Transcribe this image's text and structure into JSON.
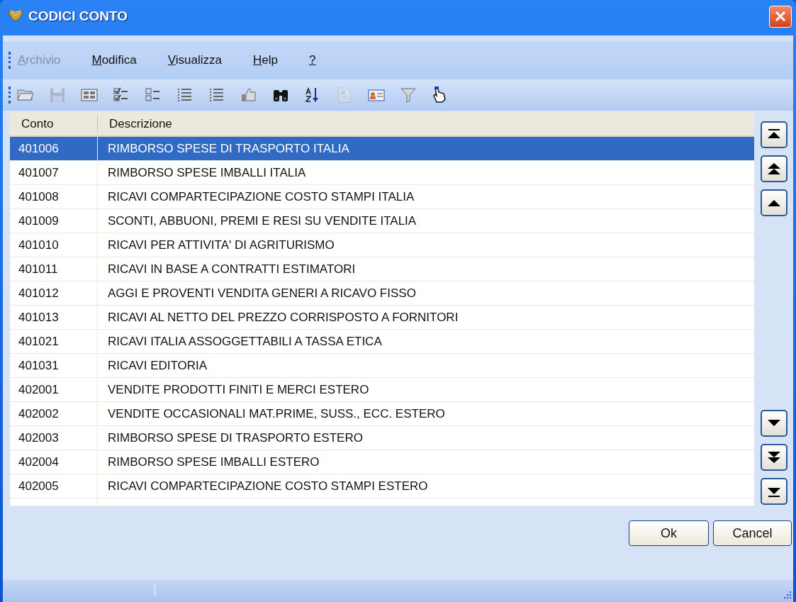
{
  "window": {
    "title": "CODICI CONTO"
  },
  "menu": [
    {
      "label": "Archivio",
      "disabled": true
    },
    {
      "label": "Modifica",
      "disabled": false
    },
    {
      "label": "Visualizza",
      "disabled": false
    },
    {
      "label": "Help",
      "disabled": false
    },
    {
      "label": "?",
      "disabled": false
    }
  ],
  "toolbar": [
    {
      "kind": "open",
      "disabled": false
    },
    {
      "kind": "save",
      "disabled": true
    },
    {
      "kind": "form",
      "disabled": false
    },
    {
      "kind": "checklist",
      "disabled": false
    },
    {
      "kind": "list",
      "disabled": false
    },
    {
      "kind": "dotlist",
      "disabled": false
    },
    {
      "kind": "dotlist",
      "disabled": false
    },
    {
      "kind": "thumb",
      "disabled": false
    },
    {
      "kind": "binoculars",
      "disabled": false
    },
    {
      "kind": "sort",
      "disabled": false
    },
    {
      "kind": "document",
      "disabled": true
    },
    {
      "kind": "card",
      "disabled": false
    },
    {
      "kind": "filter",
      "disabled": false
    },
    {
      "kind": "pointer",
      "disabled": false
    }
  ],
  "table": {
    "columns": [
      "Conto",
      "Descrizione"
    ],
    "rows": [
      {
        "conto": "401006",
        "descrizione": "RIMBORSO SPESE DI TRASPORTO ITALIA",
        "selected": true
      },
      {
        "conto": "401007",
        "descrizione": "RIMBORSO SPESE IMBALLI ITALIA",
        "selected": false
      },
      {
        "conto": "401008",
        "descrizione": "RICAVI COMPARTECIPAZIONE COSTO STAMPI ITALIA",
        "selected": false
      },
      {
        "conto": "401009",
        "descrizione": "SCONTI, ABBUONI, PREMI E RESI SU VENDITE ITALIA",
        "selected": false
      },
      {
        "conto": "401010",
        "descrizione": "RICAVI PER ATTIVITA' DI AGRITURISMO",
        "selected": false
      },
      {
        "conto": "401011",
        "descrizione": "RICAVI IN BASE A CONTRATTI ESTIMATORI",
        "selected": false
      },
      {
        "conto": "401012",
        "descrizione": "AGGI E PROVENTI VENDITA GENERI A RICAVO FISSO",
        "selected": false
      },
      {
        "conto": "401013",
        "descrizione": "RICAVI AL NETTO DEL PREZZO CORRISPOSTO A FORNITORI",
        "selected": false
      },
      {
        "conto": "401021",
        "descrizione": "RICAVI ITALIA ASSOGGETTABILI A TASSA ETICA",
        "selected": false
      },
      {
        "conto": "401031",
        "descrizione": "RICAVI EDITORIA",
        "selected": false
      },
      {
        "conto": "402001",
        "descrizione": "VENDITE PRODOTTI FINITI E MERCI ESTERO",
        "selected": false
      },
      {
        "conto": "402002",
        "descrizione": "VENDITE OCCASIONALI MAT.PRIME, SUSS., ECC. ESTERO",
        "selected": false
      },
      {
        "conto": "402003",
        "descrizione": "RIMBORSO SPESE DI TRASPORTO ESTERO",
        "selected": false
      },
      {
        "conto": "402004",
        "descrizione": "RIMBORSO SPESE IMBALLI ESTERO",
        "selected": false
      },
      {
        "conto": "402005",
        "descrizione": "RICAVI COMPARTECIPAZIONE COSTO STAMPI ESTERO",
        "selected": false
      }
    ]
  },
  "nav_up": [
    {
      "kind": "first"
    },
    {
      "kind": "page-up"
    },
    {
      "kind": "up"
    }
  ],
  "nav_down": [
    {
      "kind": "down"
    },
    {
      "kind": "page-down"
    },
    {
      "kind": "last"
    }
  ],
  "buttons": [
    "Ok",
    "Cancel"
  ]
}
